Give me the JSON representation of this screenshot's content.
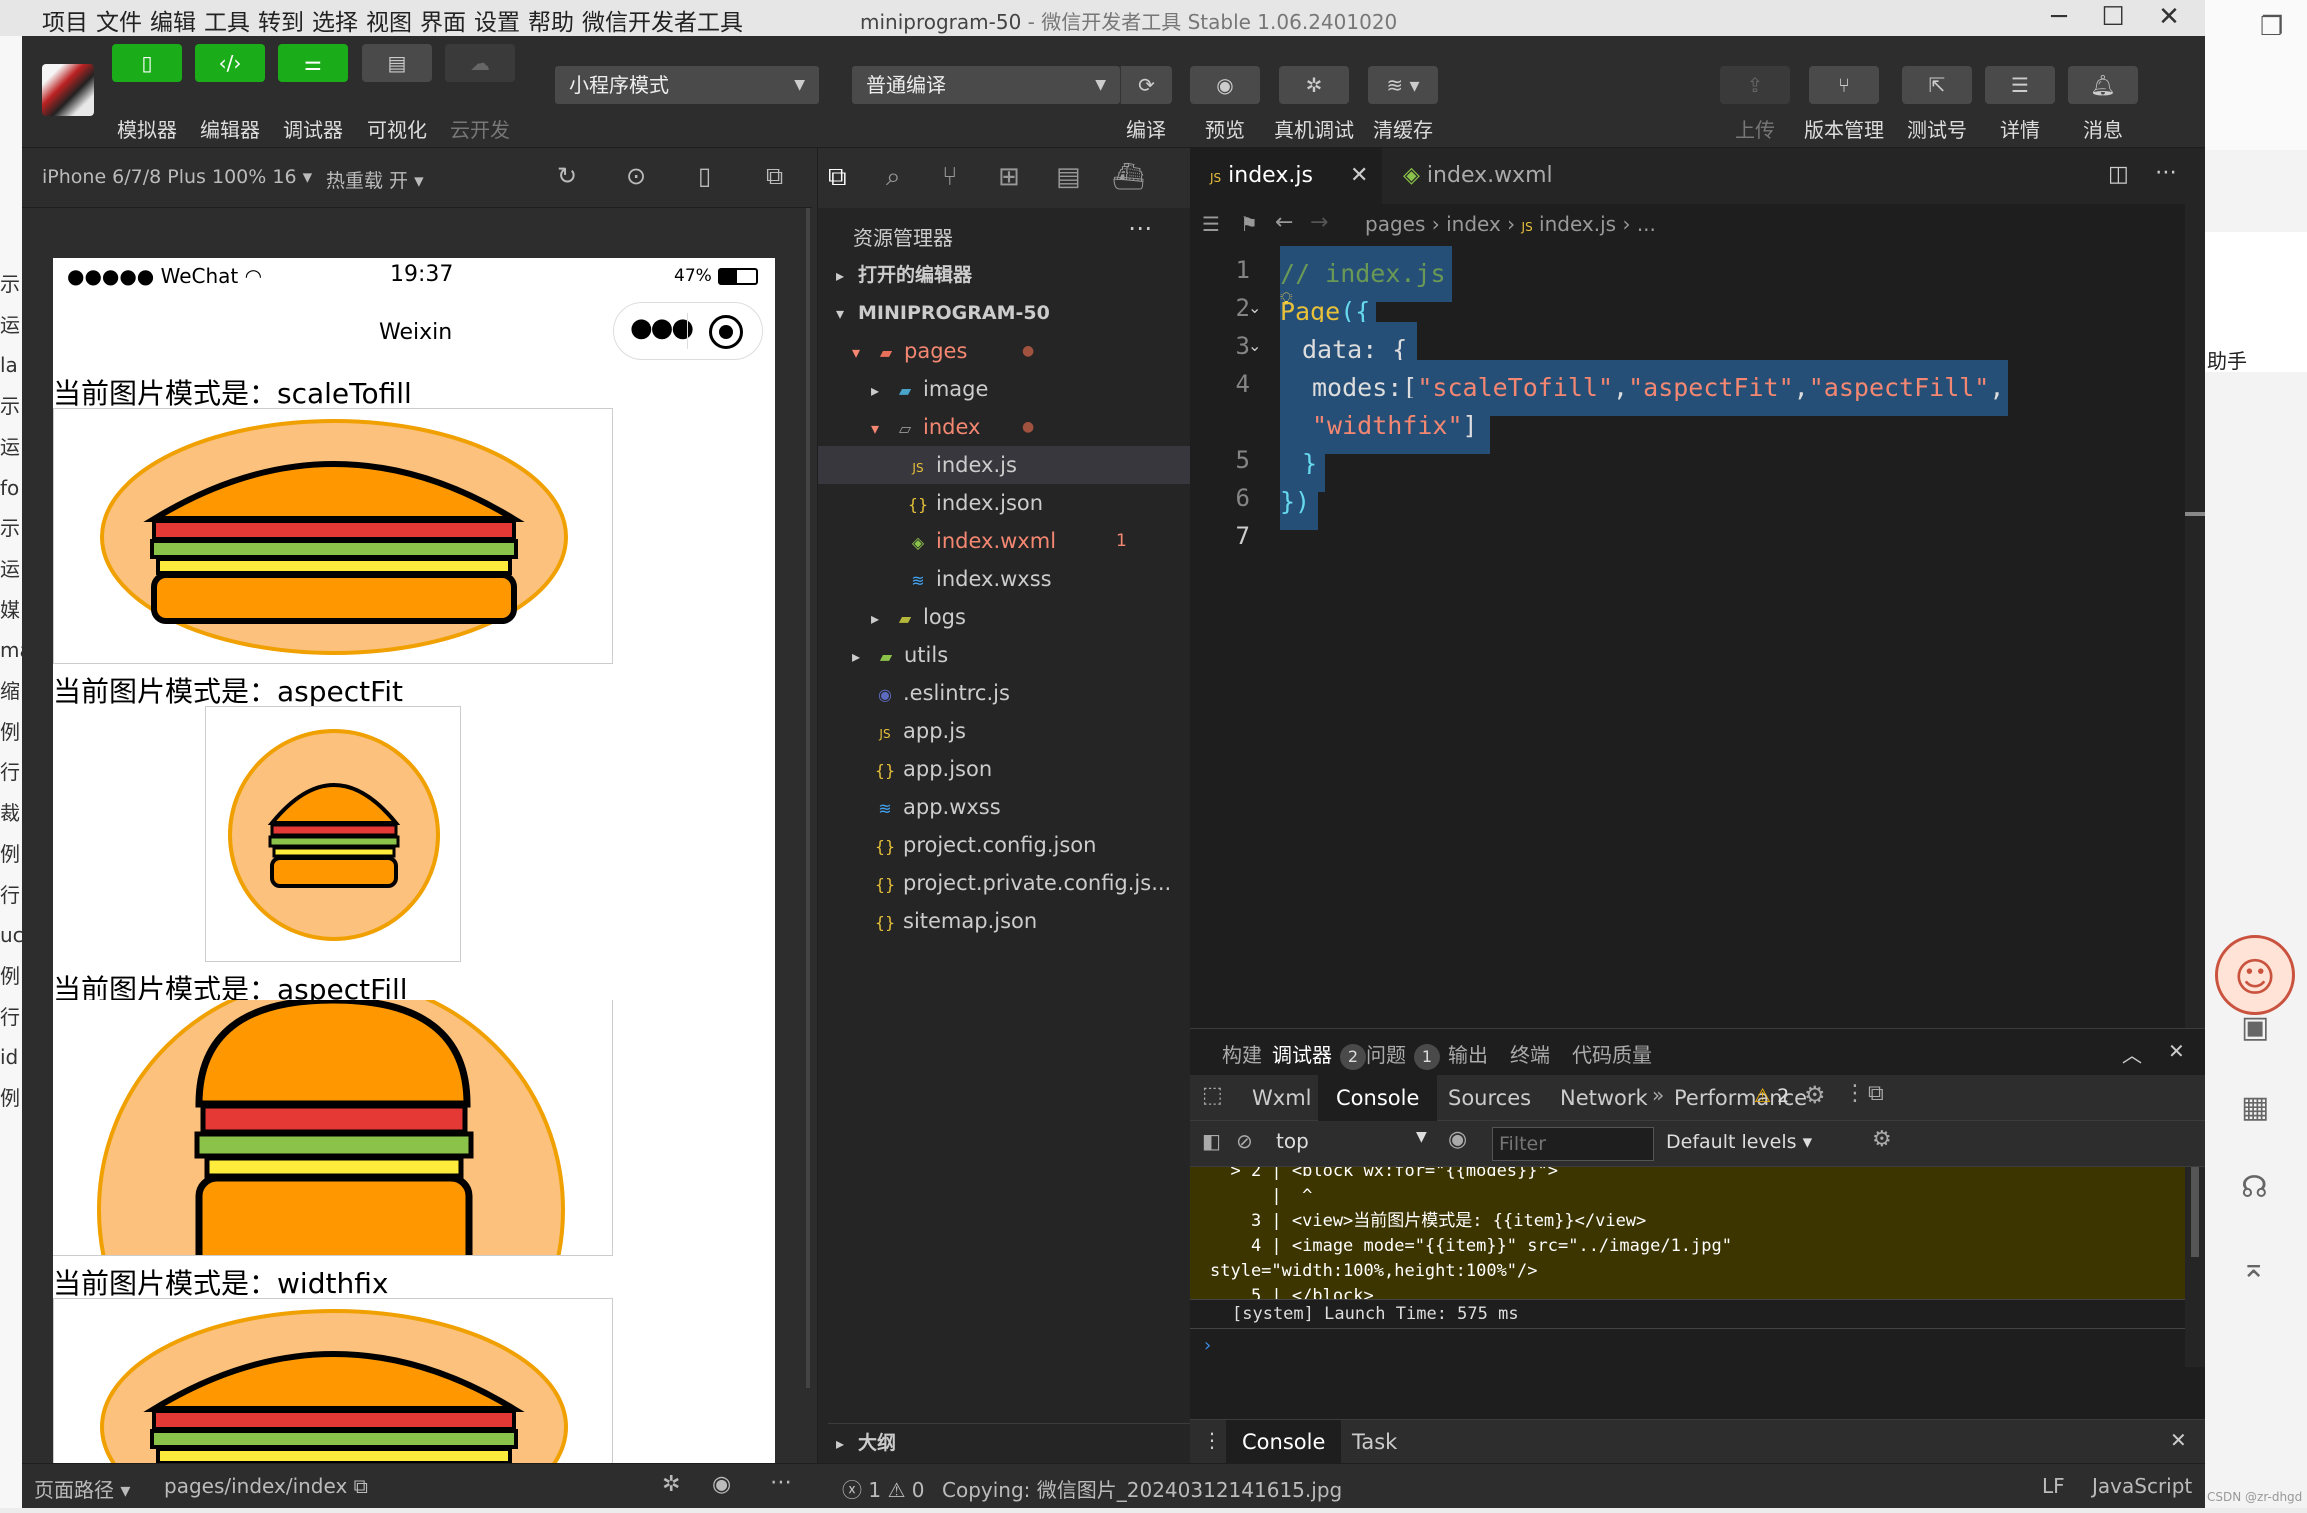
{
  "titlebar": {
    "menu": [
      "项目",
      "文件",
      "编辑",
      "工具",
      "转到",
      "选择",
      "视图",
      "界面",
      "设置",
      "帮助",
      "微信开发者工具"
    ],
    "project_name": "miniprogram-50",
    "app_title": " - 微信开发者工具 Stable 1.06.2401020"
  },
  "toolbar": {
    "simulator": "模拟器",
    "editor": "编辑器",
    "debugger": "调试器",
    "visual": "可视化",
    "cloud": "云开发",
    "mode_select": "小程序模式",
    "compile_select": "普通编译",
    "compile": "编译",
    "preview": "预览",
    "real_debug": "真机调试",
    "clear_cache": "清缓存",
    "upload": "上传",
    "version": "版本管理",
    "test_id": "测试号",
    "details": "详情",
    "messages": "消息"
  },
  "simbar": {
    "device": "iPhone 6/7/8 Plus 100% 16",
    "hot_reload": "热重载 开"
  },
  "phone": {
    "carrier": "●●●●● WeChat",
    "time": "19:37",
    "battery": "47%",
    "nav_title": "Weixin",
    "prefix": "当前图片模式是：",
    "modes": [
      "scaleTofill",
      "aspectFit",
      "aspectFill",
      "widthfix"
    ]
  },
  "explorer": {
    "title": "资源管理器",
    "open_editors": "打开的编辑器",
    "project": "MINIPROGRAM-50",
    "items": {
      "pages": "pages",
      "image": "image",
      "index": "index",
      "index_js": "index.js",
      "index_json": "index.json",
      "index_wxml": "index.wxml",
      "index_wxml_count": "1",
      "index_wxss": "index.wxss",
      "logs": "logs",
      "utils": "utils",
      "eslintrc": ".eslintrc.js",
      "app_js": "app.js",
      "app_json": "app.json",
      "app_wxss": "app.wxss",
      "project_config": "project.config.json",
      "project_private": "project.private.config.js...",
      "sitemap": "sitemap.json"
    },
    "outline": "大纲"
  },
  "editor": {
    "tabs": [
      "index.js",
      "index.wxml"
    ],
    "breadcrumb": [
      "pages",
      "index",
      "index.js",
      "..."
    ],
    "lines": {
      "l1": "// index.js",
      "l2_kw": "Page",
      "l2_rest": "({",
      "l3": "data: {",
      "l4_key": "modes:[",
      "l4_s1": "\"scaleTofill\"",
      "l4_s2": "\"aspectFit\"",
      "l4_s3": "\"aspectFill\"",
      "l4b_s4": "\"widthfix\"",
      "l5": "}",
      "l6": "})"
    },
    "line_numbers": [
      "1",
      "2",
      "3",
      "4",
      "5",
      "6",
      "7"
    ]
  },
  "panel": {
    "tabs": [
      "构建",
      "调试器",
      "问题",
      "输出",
      "终端",
      "代码质量"
    ],
    "debugger_count": "2",
    "problems_count": "1",
    "devtools_tabs": [
      "Wxml",
      "Console",
      "Sources",
      "Network",
      "Performance"
    ],
    "warnings": "2",
    "context": "top",
    "filter_placeholder": "Filter",
    "levels": "Default levels",
    "error_lines": [
      "  > 2 | <block wx:for=\"{{modes}}\">",
      "      |  ^",
      "    3 | <view>当前图片模式是: {{item}}</view>",
      "    4 | <image mode=\"{{item}}\" src=\"../image/1.jpg\"",
      "style=\"width:100%,height:100%\"/>",
      "    5 | </block>"
    ],
    "system_line": "[system] Launch Time: 575 ms",
    "drawer_tabs": [
      "Console",
      "Task"
    ]
  },
  "statusbar": {
    "page_path_label": "页面路径",
    "page_path": "pages/index/index",
    "errors": "1",
    "warnings": "0",
    "copying": "Copying: 微信图片_20240312141615.jpg",
    "eol": "LF",
    "language": "JavaScript",
    "watermark": "CSDN @zr-dhgd"
  },
  "bg_right": {
    "assistant_text": "助手"
  },
  "bg_left": {
    "fragments": [
      "示",
      "运",
      "la",
      "示",
      "运",
      "fo",
      "示",
      "运",
      "媒",
      "ma",
      "缩",
      "例",
      "行",
      "裁",
      "例",
      "行",
      "uc",
      "例",
      "行",
      "id",
      "例"
    ]
  }
}
